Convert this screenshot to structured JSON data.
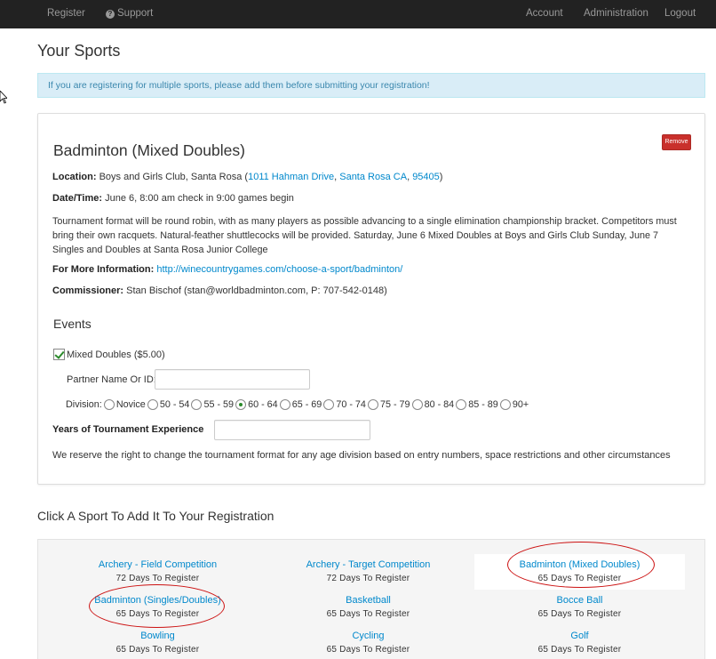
{
  "nav": {
    "register": "Register",
    "support": "Support",
    "account": "Account",
    "administration": "Administration",
    "logout": "Logout"
  },
  "page_title": "Your Sports",
  "alert": "If you are registering for multiple sports, please add them before submitting your registration!",
  "sport": {
    "title": "Badminton (Mixed Doubles)",
    "remove_label": "Remove",
    "location_label": "Location:",
    "location_text": "Boys and Girls Club, Santa Rosa (",
    "address_street": "1011 Hahman Drive",
    "address_city": "Santa Rosa CA",
    "address_zip": "95405",
    "datetime_label": "Date/Time:",
    "datetime_text": "June 6, 8:00 am check in 9:00 games begin",
    "description": "Tournament format will be round robin, with as many players as possible advancing to a single elimination championship bracket. Competitors must bring their own racquets. Natural-feather shuttlecocks will be provided. Saturday, June 6 Mixed Doubles at Boys and Girls Club Sunday, June 7 Singles and Doubles at Santa Rosa Junior College",
    "more_info_label": "For More Information:",
    "more_info_url": "http://winecountrygames.com/choose-a-sport/badminton/",
    "commissioner_label": "Commissioner:",
    "commissioner_text": "Stan Bischof (stan@worldbadminton.com, P: 707-542-0148)",
    "events_heading": "Events",
    "event_label": "Mixed Doubles ($5.00)",
    "event_checked": true,
    "partner_label": "Partner Name Or ID:",
    "partner_value": "",
    "division_label": "Division:",
    "divisions": [
      "Novice",
      "50 - 54",
      "55 - 59",
      "60 - 64",
      "65 - 69",
      "70 - 74",
      "75 - 79",
      "80 - 84",
      "85 - 89",
      "90+"
    ],
    "division_selected": "60 - 64",
    "experience_label": "Years of Tournament Experience",
    "experience_value": "",
    "disclaimer": "We reserve the right to change the tournament format for any age division based on entry numbers, space restrictions and other circumstances"
  },
  "add_sport_heading": "Click A Sport To Add It To Your Registration",
  "sports_grid": [
    {
      "name": "Archery - Field Competition",
      "days": "72 Days To Register"
    },
    {
      "name": "Archery - Target Competition",
      "days": "72 Days To Register"
    },
    {
      "name": "Badminton (Mixed Doubles)",
      "days": "65 Days To Register",
      "selected": true,
      "circled": true
    },
    {
      "name": "Badminton (Singles/Doubles)",
      "days": "65 Days To Register",
      "circled": true
    },
    {
      "name": "Basketball",
      "days": "65 Days To Register"
    },
    {
      "name": "Bocce Ball",
      "days": "65 Days To Register"
    },
    {
      "name": "Bowling",
      "days": "65 Days To Register"
    },
    {
      "name": "Cycling",
      "days": "65 Days To Register"
    },
    {
      "name": "Golf",
      "days": "65 Days To Register"
    }
  ],
  "colors": {
    "navbar": "#222222",
    "link": "#0088cc",
    "alert_bg": "#d9edf7",
    "alert_text": "#3a87ad",
    "danger": "#c9302c",
    "annotation": "#cc1111"
  }
}
